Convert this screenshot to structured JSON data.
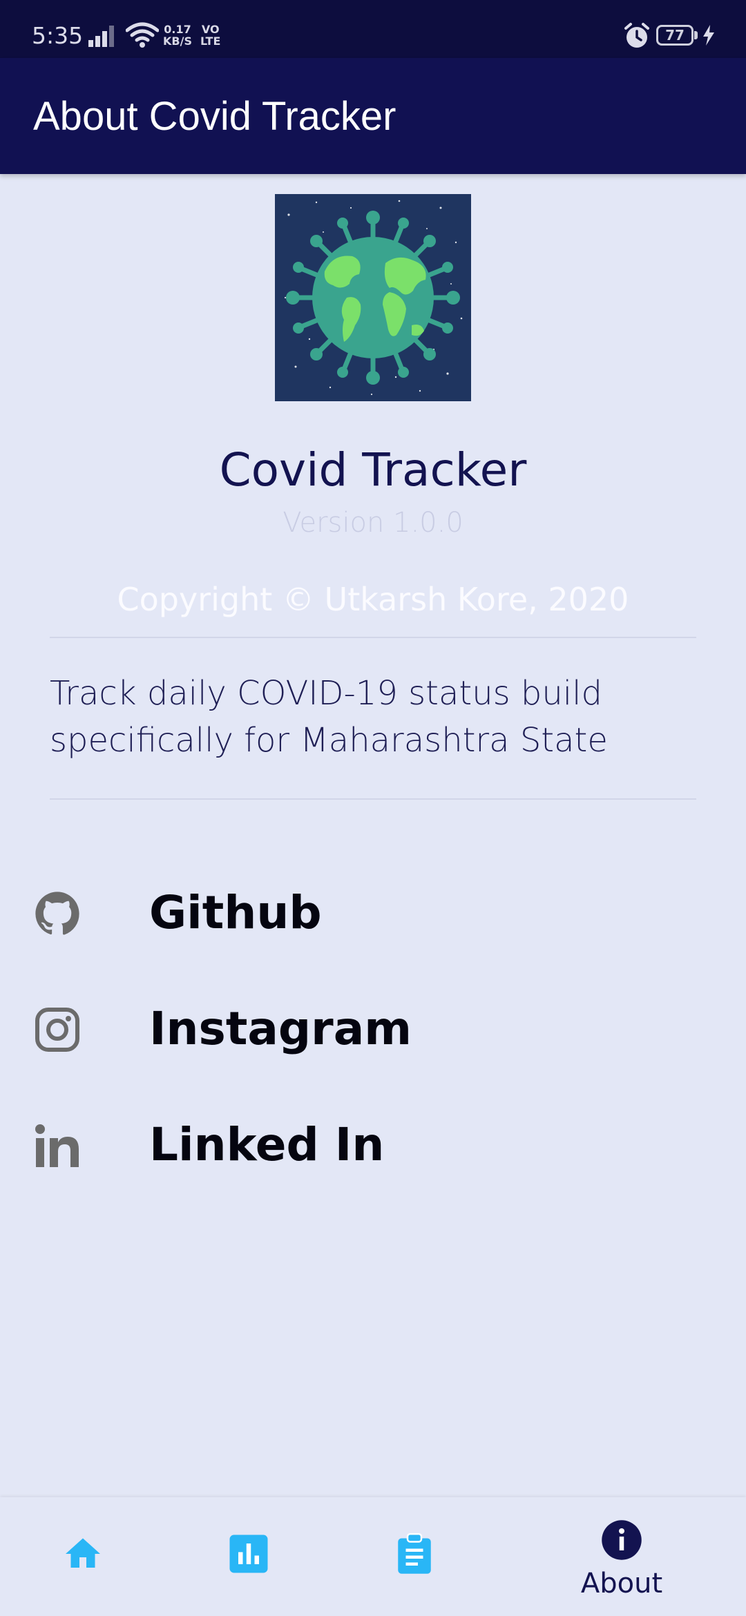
{
  "status_bar": {
    "time": "5:35",
    "net_speed_value": "0.17",
    "net_speed_unit": "KB/S",
    "volte_top": "VO",
    "volte_bottom": "LTE",
    "battery": "77",
    "icons": [
      "signal-icon",
      "wifi-icon",
      "alarm-icon",
      "battery-icon",
      "charging-icon"
    ]
  },
  "app_bar": {
    "title": "About Covid Tracker"
  },
  "about": {
    "app_name": "Covid Tracker",
    "version": "Version 1.0.0",
    "copyright": "Copyright © Utkarsh Kore, 2020",
    "description": "Track daily COVID-19 status build specifically for Maharashtra State"
  },
  "links": [
    {
      "label": "Github",
      "icon": "github-icon"
    },
    {
      "label": "Instagram",
      "icon": "instagram-icon"
    },
    {
      "label": "Linked In",
      "icon": "linkedin-icon"
    }
  ],
  "bottom_nav": {
    "items": [
      {
        "icon": "home-icon",
        "label": ""
      },
      {
        "icon": "bar-chart-icon",
        "label": ""
      },
      {
        "icon": "clipboard-list-icon",
        "label": ""
      },
      {
        "icon": "info-icon",
        "label": "About",
        "active": true
      }
    ]
  },
  "colors": {
    "primary_dark": "#0d0d3e",
    "app_bar": "#111152",
    "background": "#e3e7f6",
    "nav_inactive": "#29b6f6",
    "nav_active": "#131350",
    "logo_bg": "#1f3560",
    "logo_earth": "#3aa48e",
    "logo_land": "#7be06a"
  }
}
